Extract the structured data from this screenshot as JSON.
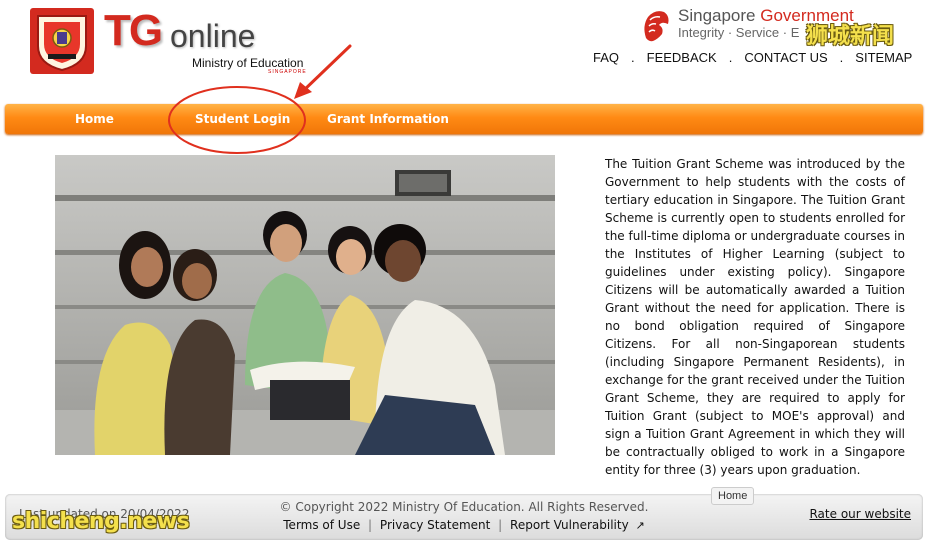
{
  "header": {
    "logo_main": "TG",
    "logo_sub": "online",
    "ministry": "Ministry of Education",
    "ministry_country": "SINGAPORE",
    "gov_title_prefix": "Singapore ",
    "gov_title_accent": "Government",
    "gov_tagline": "Integrity · Service · E",
    "watermark_cn": "狮城新闻",
    "top_links": [
      "FAQ",
      "FEEDBACK",
      "CONTACT US",
      "SITEMAP"
    ],
    "top_link_separator": "."
  },
  "nav": {
    "items": [
      "Home",
      "Student Login",
      "Grant Information"
    ]
  },
  "main": {
    "photo_icon": "students-group-photo",
    "intro_text": "The Tuition Grant Scheme was introduced by the Government to help students with the costs of tertiary education in Singapore. The Tuition Grant Scheme is currently open to students enrolled for the full-time diploma or undergraduate courses in the Institutes of Higher Learning (subject to guidelines under existing policy). Singapore Citizens will be automatically awarded a Tuition Grant without the need for application. There is no bond obligation required of Singapore Citizens. For all non-Singaporean students (including Singapore Permanent Residents), in exchange for the grant received under the Tuition Grant Scheme, they are required to apply for Tuition Grant (subject to MOE's approval) and sign a Tuition Grant Agreement in which they will be contractually obliged to work in a Singapore entity for three (3) years upon graduation."
  },
  "footer": {
    "last_updated": "Last updated on 20/04/2022",
    "copyright": "© Copyright 2022 Ministry Of Education. All Rights Reserved.",
    "links": [
      "Terms of Use",
      "Privacy Statement",
      "Report Vulnerability"
    ],
    "link_separator": "|",
    "external_icon": "↗",
    "rate_label": "Rate our website",
    "tooltip": "Home",
    "watermark_en": "shicheng.news"
  },
  "colors": {
    "brand_red": "#d32a1f",
    "nav_orange": "#ff8a14",
    "annotation_red": "#e0301e"
  }
}
